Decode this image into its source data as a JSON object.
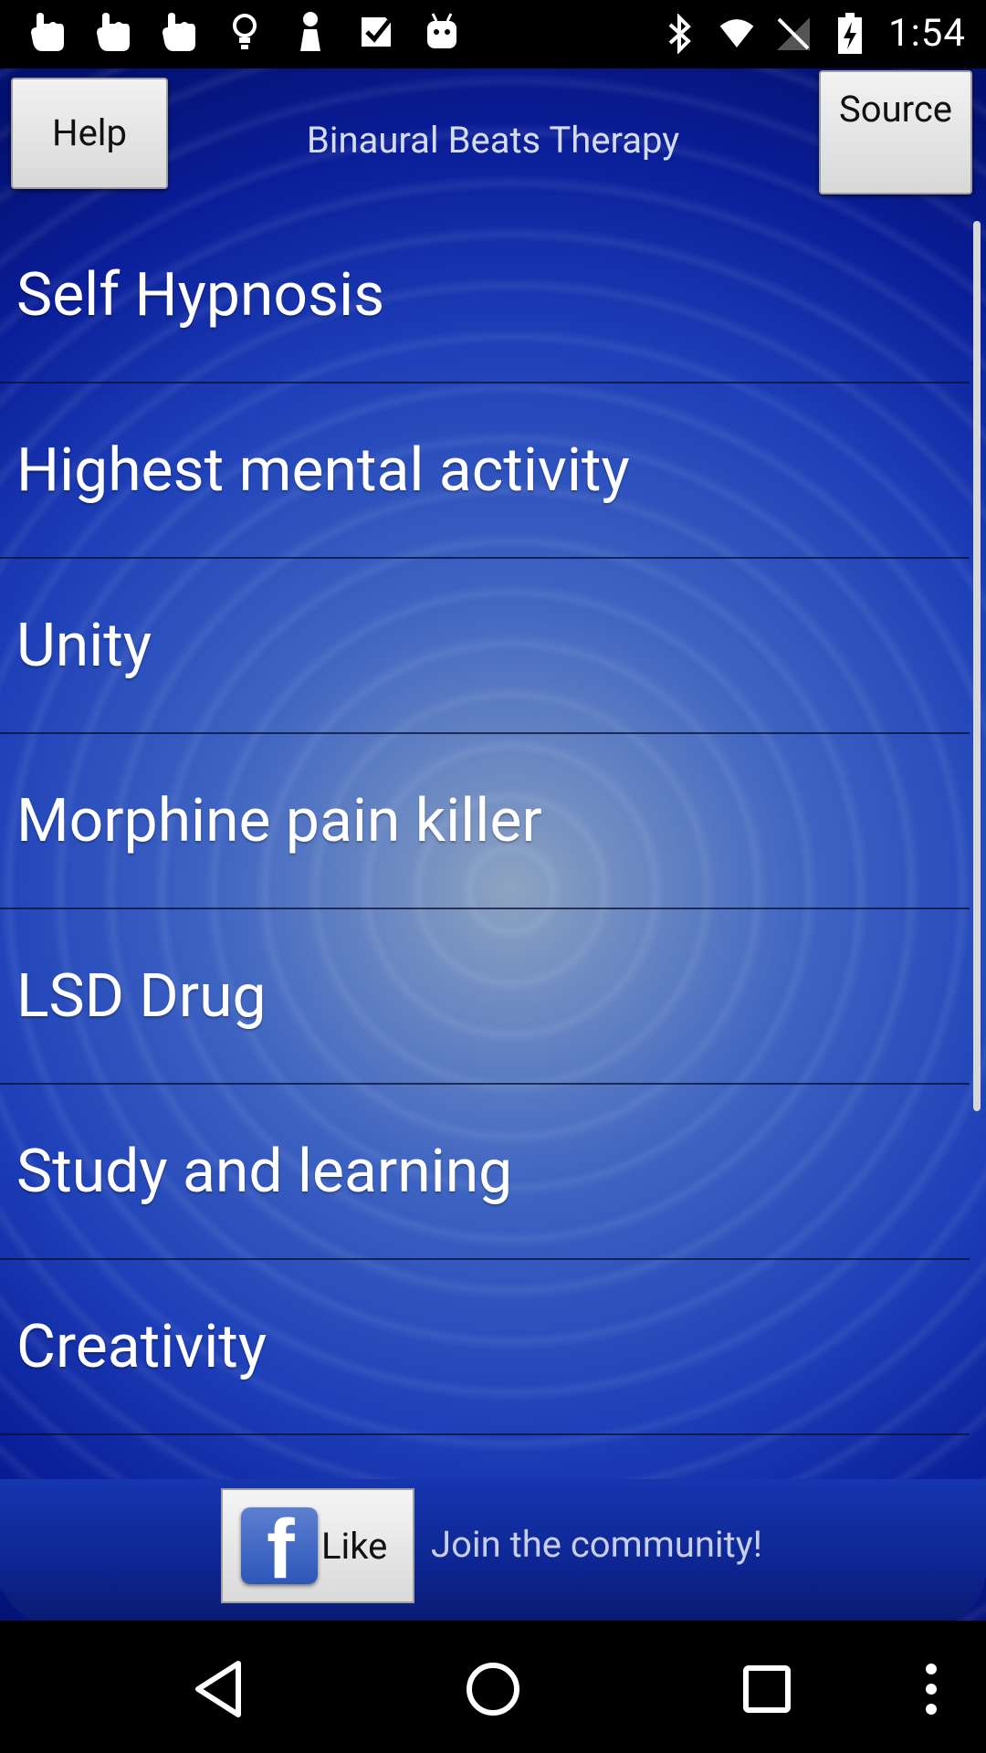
{
  "status_bar": {
    "time": "1:54",
    "icons_left": [
      "hand-icon",
      "hand-icon",
      "hand-icon",
      "lightbulb-icon",
      "figure-icon",
      "checkbox-icon",
      "android-icon"
    ],
    "icons_right": [
      "bluetooth-icon",
      "wifi-icon",
      "no-signal-icon",
      "battery-charging-icon"
    ]
  },
  "header": {
    "help_label": "Help",
    "title": "Binaural Beats Therapy",
    "source_label": "Source"
  },
  "list": {
    "items": [
      {
        "label": "Self Hypnosis"
      },
      {
        "label": "Highest mental activity"
      },
      {
        "label": "Unity"
      },
      {
        "label": "Morphine pain killer"
      },
      {
        "label": "LSD Drug"
      },
      {
        "label": "Study and learning"
      },
      {
        "label": "Creativity"
      }
    ]
  },
  "footer": {
    "like_label": "Like",
    "join_text": "Join the community!"
  },
  "colors": {
    "background_deep": "#031070",
    "background_center": "#8ea4c2",
    "button_bg": "#e6e6e6"
  }
}
